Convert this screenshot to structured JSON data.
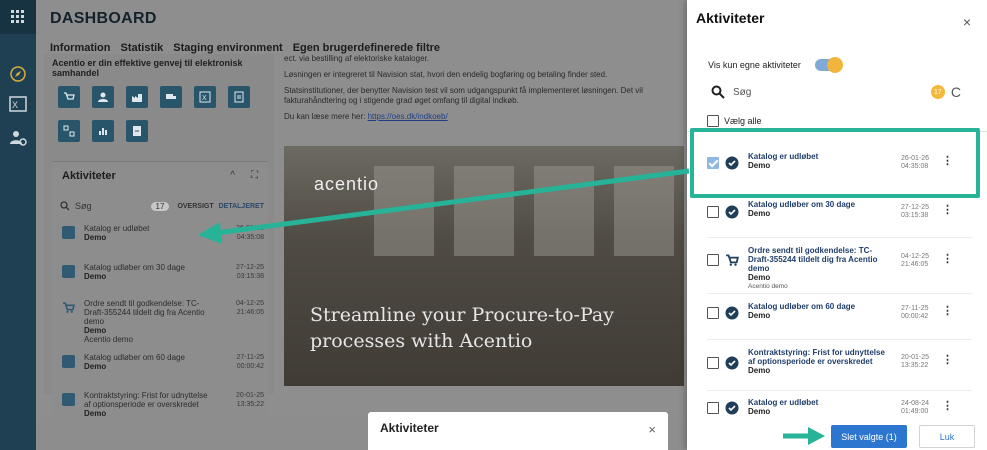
{
  "app": {
    "title": "DASHBOARD"
  },
  "nav": [
    "Information",
    "Statistik",
    "Staging environment",
    "Egen brugerdefinerede filtre"
  ],
  "left_panel": {
    "title": "Acentio er din effektive genvej til elektronisk samhandel",
    "activities": {
      "title": "Aktiviteter",
      "search_placeholder": "Søg",
      "count": "17",
      "link_overview": "OVERSIGT",
      "link_detail": "DETALJERET",
      "items": [
        {
          "title": "Katalog er udløbet",
          "sub": "Demo",
          "date": "26-01-26",
          "time": "04:35:08"
        },
        {
          "title": "Katalog udløber om 30 dage",
          "sub": "Demo",
          "date": "27-12-25",
          "time": "03:15:38"
        },
        {
          "title": "Ordre sendt til godkendelse: TC-Draft-355244 tildelt dig fra Acentio demo",
          "sub": "Demo",
          "sub2": "Acentio demo",
          "date": "04-12-25",
          "time": "21:46:05"
        },
        {
          "title": "Katalog udløber om 60 dage",
          "sub": "Demo",
          "date": "27-11-25",
          "time": "00:00:42"
        },
        {
          "title": "Kontraktstyring: Frist for udnyttelse af optionsperiode er overskredet",
          "sub": "Demo",
          "date": "20-01-25",
          "time": "13:35:22"
        }
      ]
    }
  },
  "content": {
    "p1": "ect. via bestilling af elektoriske kataloger.",
    "p2": "Løsningen er integreret til Navision stat, hvori den endelig bogføring og betaling finder sted.",
    "p3": "Statsinstitutioner, der benytter Navision test vil som udgangspunkt få implementeret løsningen. Det vil fakturahåndtering og i stigende grad øget omfang til digital indkøb.",
    "link_prefix": "Du kan læse mere her:",
    "link": "https://oes.dk/indkoeb/",
    "hero_logo": "acentio",
    "hero_tagline_1": "Streamline your Procure-to-Pay",
    "hero_tagline_2": "processes with Acentio"
  },
  "bottom_dialog": {
    "title": "Aktiviteter",
    "close": "×"
  },
  "drawer": {
    "title": "Aktiviteter",
    "close": "×",
    "toggle_label": "Vis kun egne aktiviteter",
    "toggle_on": true,
    "search_placeholder": "Søg",
    "count": "17",
    "refresh": "C",
    "select_all": "Vælg alle",
    "items": [
      {
        "icon": "check-circle-icon",
        "checked": true,
        "title": "Katalog er udløbet",
        "sub": "Demo",
        "sub2": "",
        "date": "26-01-26",
        "time": "04:35:08"
      },
      {
        "icon": "check-circle-icon",
        "checked": false,
        "title": "Katalog udløber om 30 dage",
        "sub": "Demo",
        "sub2": "",
        "date": "27-12-25",
        "time": "03:15:38"
      },
      {
        "icon": "cart-icon",
        "checked": false,
        "title": "Ordre sendt til godkendelse: TC-Draft-355244 tildelt dig fra Acentio demo",
        "sub": "Demo",
        "sub2": "Acentio demo",
        "date": "04-12-25",
        "time": "21:46:05"
      },
      {
        "icon": "check-circle-icon",
        "checked": false,
        "title": "Katalog udløber om 60 dage",
        "sub": "Demo",
        "sub2": "",
        "date": "27-11-25",
        "time": "00:00:42"
      },
      {
        "icon": "check-circle-icon",
        "checked": false,
        "title": "Kontraktstyring: Frist for udnyttelse af optionsperiode er overskredet",
        "sub": "Demo",
        "sub2": "",
        "date": "20-01-25",
        "time": "13:35:22"
      },
      {
        "icon": "check-circle-icon",
        "checked": false,
        "title": "Katalog er udløbet",
        "sub": "Demo",
        "sub2": "",
        "date": "24-08-24",
        "time": "01:49:00"
      }
    ],
    "delete_button": "Slet valgte (1)",
    "close_button": "Luk"
  },
  "colors": {
    "accent": "#26b398",
    "primary": "#2d76d0",
    "badge": "#f3b83c",
    "rail": "#1f3f52"
  }
}
